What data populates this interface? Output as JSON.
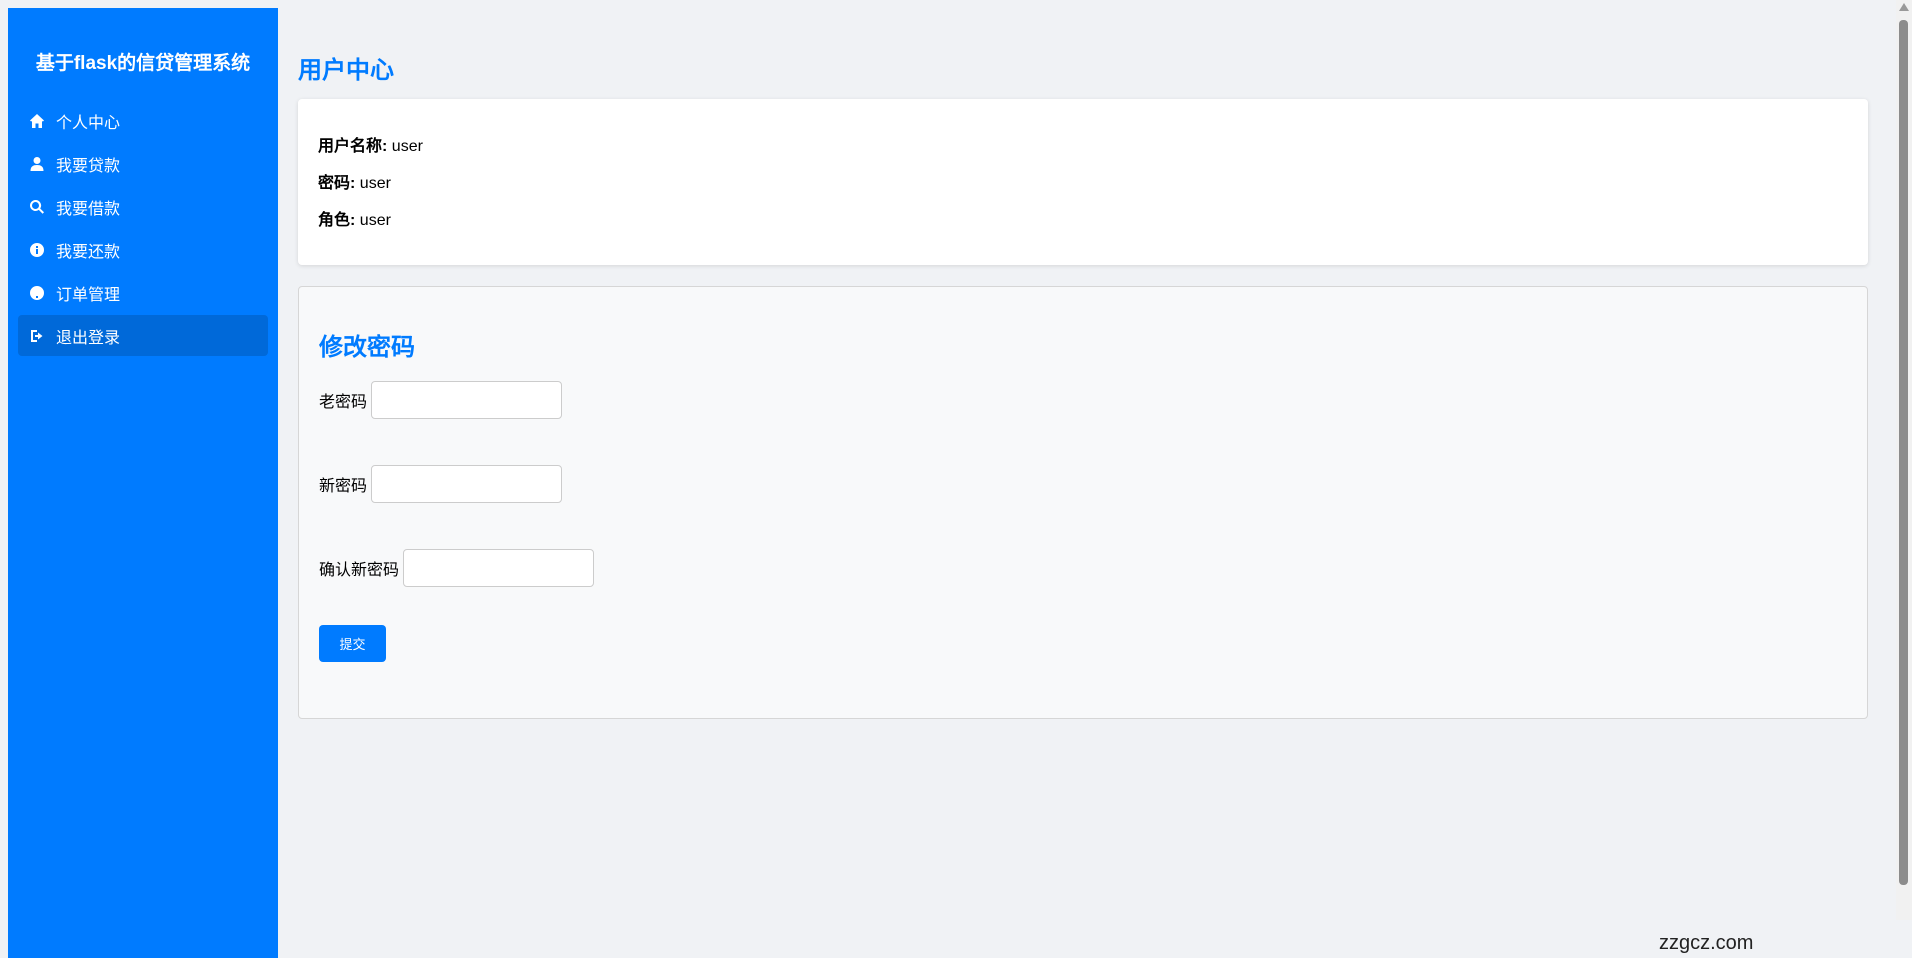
{
  "sidebar": {
    "brand": "基于flask的信贷管理系统",
    "items": [
      {
        "label": "个人中心",
        "icon": "home-icon"
      },
      {
        "label": "我要贷款",
        "icon": "user-icon"
      },
      {
        "label": "我要借款",
        "icon": "search-icon"
      },
      {
        "label": "我要还款",
        "icon": "info-icon"
      },
      {
        "label": "订单管理",
        "icon": "question-icon"
      },
      {
        "label": "退出登录",
        "icon": "sign-out-icon",
        "active": true
      }
    ]
  },
  "main": {
    "title": "用户中心",
    "info": {
      "username_label": "用户名称:",
      "username_value": "user",
      "password_label": "密码:",
      "password_value": "user",
      "role_label": "角色:",
      "role_value": "user"
    },
    "change_password": {
      "title": "修改密码",
      "old_label": "老密码",
      "old_value": "",
      "new_label": "新密码",
      "new_value": "",
      "confirm_label": "确认新密码",
      "confirm_value": "",
      "submit_label": "提交"
    }
  },
  "watermark": "zzgcz.com",
  "colors": {
    "accent": "#007bff",
    "active": "#0069d9",
    "background": "#f0f2f5"
  }
}
